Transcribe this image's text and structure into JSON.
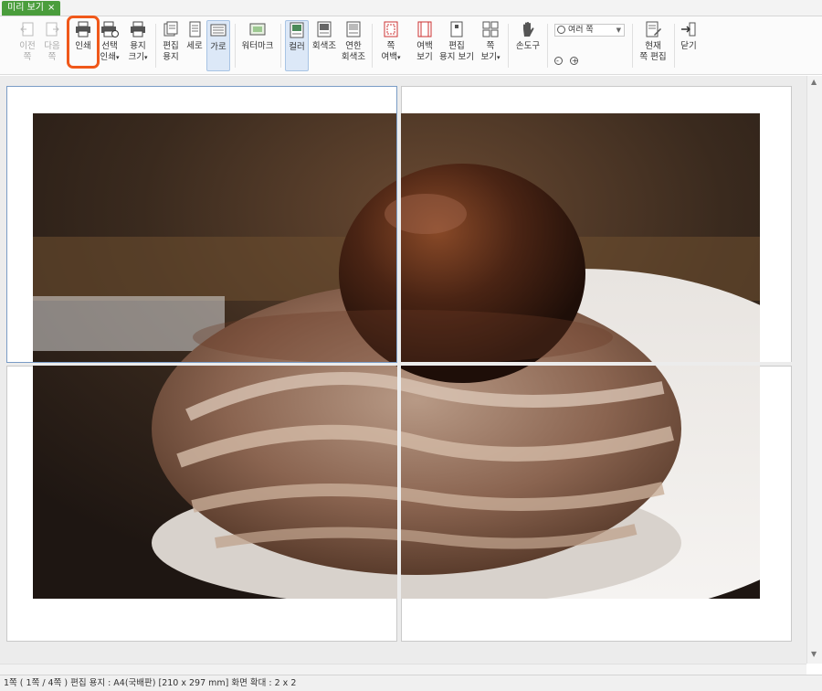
{
  "tab": {
    "label": "미리 보기",
    "close": "×"
  },
  "toolbar": {
    "prev": "이전\n쪽",
    "next": "다음\n쪽",
    "print": "인쇄",
    "select_print": "선택\n인쇄",
    "paper_size": "용지\n크기",
    "edit_paper": "편집\n용지",
    "portrait": "세로",
    "landscape": "가로",
    "watermark": "워터마크",
    "color": "컬러",
    "grayscale": "회색조",
    "light_grayscale": "연한\n회색조",
    "page_margin": "쪽\n여백",
    "margin_view": "여백\n보기",
    "edit_paper_view": "편집\n용지 보기",
    "page_view": "쪽\n보기",
    "hand_tool": "손도구",
    "zoom_value": "여러 쪽",
    "current_page_edit": "현재\n쪽 편집",
    "close": "닫기"
  },
  "status": {
    "text": "1쪽 ( 1쪽 / 4쪽 ) 편집 용지 : A4(국배판) [210 x 297 mm] 화면 확대 : 2 x 2"
  },
  "colors": {
    "tab_green": "#4a9d3c",
    "highlight": "#f0581a",
    "active_bg": "#dce8f7"
  }
}
